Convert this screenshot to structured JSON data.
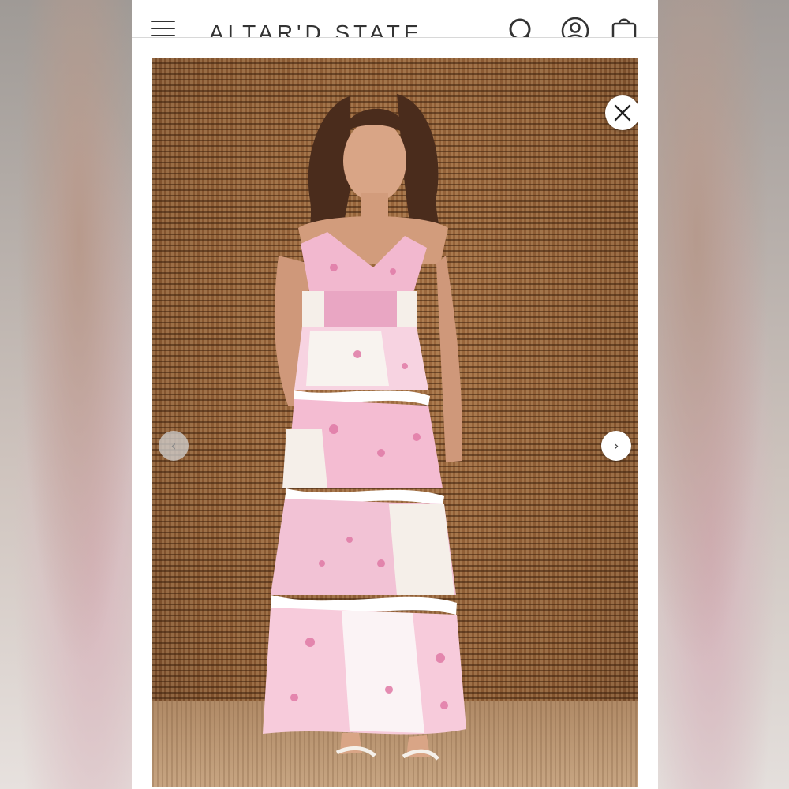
{
  "header": {
    "brand": "ALTAR'D STATE",
    "icons": [
      "menu-icon",
      "search-icon",
      "account-icon",
      "shopping-bag-icon"
    ]
  },
  "gallery": {
    "prev_glyph": "‹",
    "next_glyph": "›",
    "close_icon": "close-icon",
    "image": "product-photo-floral-tiered-maxi-dress"
  },
  "colors": {
    "accent_pink": "#e9a6c3",
    "backdrop_woven": "#8a5a33",
    "text_dark": "#333333"
  }
}
